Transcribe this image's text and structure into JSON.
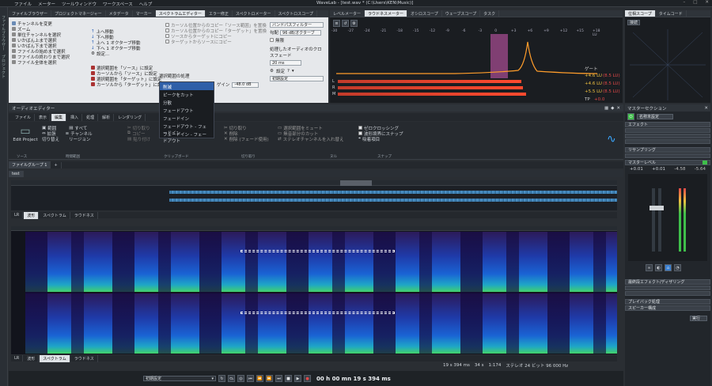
{
  "app": {
    "menu": [
      "ファイル",
      "メーター",
      "ツールウィンドウ",
      "ワークスペース",
      "ヘルプ"
    ],
    "title": "WaveLab - [test.wav * (C:\\Users\\KEN\\Music)]",
    "left_tabs": [
      "ファイルブラウザー",
      "プロジェクト"
    ]
  },
  "upper_tabs": [
    "ファイルブラウザー",
    "プロジェクトマネージャー",
    "メタデータ",
    "マーカー",
    "スペクトラムエディター",
    "エラー修正",
    "スペクトロメーター",
    "スペクトロスコープ"
  ],
  "spectrum_editor": {
    "nav_items": [
      "チャンネルを変更",
      "ズーム",
      "単位チャンネルを選択",
      "いかばん上まで選択",
      "いかばん下まで選択",
      "ファイルの始めまで選択",
      "ファイルの終わりまで選択",
      "ファイル全体を選択"
    ],
    "move_items": [
      "上へ移動",
      "下へ移動",
      "上へ 1 オクターブ移動",
      "下へ 1 オクターブ移動",
      "設定..."
    ],
    "copy_items": [
      "選択範囲を「ソース」に設定",
      "カーソルから「ソース」に設定",
      "選択範囲を「ターゲット」に設定",
      "カーソルから「ターゲット」に設定"
    ],
    "mid_items": [
      "カーソル位置からのコピー「ソース範囲」を置換",
      "カーソル位置からのコピー「ターゲット」を置換",
      "ソースからターゲットにコピー",
      "ターゲットからソースにコピー"
    ],
    "filter_label": "バンドパスフィルター",
    "gain_value": "96 dB/オクターブ",
    "mute_label": "無限",
    "section_label": "選択範囲の処理",
    "process_dropdown": "削減",
    "gain_label": "ゲイン",
    "gain_input": "-48.0 dB",
    "process_label": "処理したオーディオのクロスフェード",
    "crossfade_value": "20 ms",
    "settings_label": "設定",
    "preset_label": "初期設定",
    "dropdown_options": [
      "削減",
      "ピークをカット",
      "分散",
      "フェードアウト",
      "フェードイン",
      "フェードアウト - フェードイン",
      "フェードイン - フェードアウト"
    ]
  },
  "meter_tabs": [
    "レベルメーター",
    "ラウドネスメーター",
    "オシロスコープ",
    "ウェーブスコープ",
    "タスク"
  ],
  "loudness": {
    "scale": [
      "-30",
      "-27",
      "-24",
      "-21",
      "-18",
      "-15",
      "-12",
      "-9",
      "-6",
      "-3",
      "0",
      "+3",
      "+6",
      "+9",
      "+12",
      "+15",
      "+18 LU"
    ],
    "gate_label": "ゲート",
    "readings": [
      {
        "value": "+4.6 LU",
        "max": "(8.5 LU)"
      },
      {
        "value": "+4.6 LU",
        "max": "(8.5 LU)"
      },
      {
        "value": "+5.5 LU",
        "max": "(8.5 LU)"
      }
    ],
    "rows": [
      "L",
      "R",
      "M"
    ],
    "tp_label": "TP",
    "tp_value": "+0.0"
  },
  "scope_tabs": [
    "位相スコープ",
    "タイムコード"
  ],
  "scope_label": "接続",
  "audio_editor": {
    "title": "オーディオエディター",
    "ribbon_tabs": [
      "ファイル",
      "表示",
      "編集",
      "挿入",
      "処理",
      "解析",
      "レンダリング"
    ],
    "groups": [
      {
        "label": "ソース",
        "items": [
          "Edit Project"
        ]
      },
      {
        "label": "時間範囲",
        "items": [
          "範囲",
          "すべて",
          "拡張",
          "チャンネル",
          "切り替え",
          "リージョン"
        ]
      },
      {
        "label": "クリップボード",
        "items": [
          "切り取り",
          "コピー",
          "貼り付け"
        ]
      },
      {
        "label": "切り取り",
        "items": [
          "切り取り",
          "削除",
          "削除 (フェード使用)"
        ]
      },
      {
        "label": "ヌル",
        "items": [
          "選択範囲をミュート",
          "無音部分のカット",
          "ステレオチャンネルを入れ替え"
        ]
      },
      {
        "label": "スナップ",
        "items": [
          "ゼロクロッシング",
          "波形境界にスナップ",
          "吸着項目"
        ]
      }
    ],
    "file_group_tab": "ファイルグループ 1",
    "file_tab": "test",
    "overview_tabs": [
      "LR",
      "波形",
      "スペクトラム",
      "ラウドネス"
    ],
    "main_tabs": [
      "LR",
      "波形",
      "スペクトラム",
      "ラウドネス"
    ],
    "status": {
      "time1": "19 s 394 ms",
      "time2": "34 s",
      "zoom": "1:174",
      "format": "ステレオ 24 ビット 96 000 Hz"
    }
  },
  "transport": {
    "preset": "初期設定",
    "time": "00 h 00 mn 19 s 394 ms"
  },
  "master": {
    "title": "マスターセクション",
    "preset_btn": "名称未設定",
    "effects_label": "エフェクト",
    "resampling_label": "リサンプリング",
    "master_level_label": "マスターレベル",
    "levels": [
      "+0.01",
      "+0.01",
      "-4.58",
      "-5.64"
    ],
    "final_label": "最終段エフェクト/ディザリング",
    "playback_label": "プレイバック処理",
    "speaker_label": "スピーカー構成",
    "render_btn": "実行"
  },
  "colors": {
    "accent": "#ff9d2b",
    "pink": "#e86ad0",
    "meter_red": "#c0392b"
  }
}
